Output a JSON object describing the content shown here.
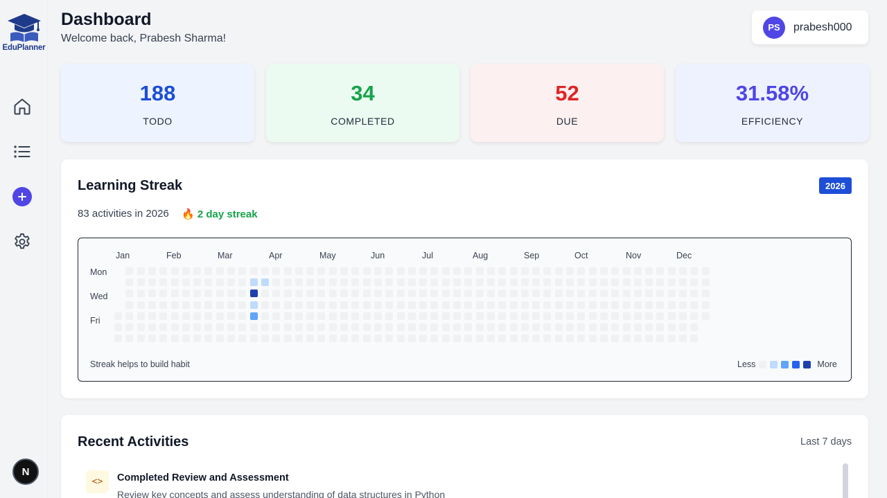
{
  "sidebar": {
    "logo_text": "EduPlanner",
    "bottom_badge": "N",
    "icons": [
      "home-icon",
      "list-icon",
      "plus-icon",
      "gear-icon"
    ]
  },
  "header": {
    "title": "Dashboard",
    "subtitle": "Welcome back, Prabesh Sharma!",
    "user_initials": "PS",
    "username": "prabesh000"
  },
  "stats": [
    {
      "value": "188",
      "label": "TODO",
      "color": "#1d4ed8"
    },
    {
      "value": "34",
      "label": "COMPLETED",
      "color": "#16a34a"
    },
    {
      "value": "52",
      "label": "DUE",
      "color": "#dc2626"
    },
    {
      "value": "31.58%",
      "label": "EFFICIENCY",
      "color": "#4f46e5"
    }
  ],
  "streak": {
    "title": "Learning Streak",
    "year": "2026",
    "activity_count": "83 activities in 2026",
    "streak_text": "2 day streak",
    "months": [
      "Jan",
      "Feb",
      "Mar",
      "Apr",
      "May",
      "Jun",
      "Jul",
      "Aug",
      "Sep",
      "Oct",
      "Nov",
      "Dec"
    ],
    "day_labels": [
      "Mon",
      "Wed",
      "Fri"
    ],
    "footer": "Streak helps to build habit",
    "legend_less": "Less",
    "legend_more": "More",
    "legend_colors": [
      "#f0f1f3",
      "#bfdbfe",
      "#60a5fa",
      "#2563eb",
      "#1e40af"
    ],
    "active_cells": [
      {
        "week": 12,
        "day": 1,
        "level": 1
      },
      {
        "week": 13,
        "day": 1,
        "level": 1
      },
      {
        "week": 12,
        "day": 2,
        "level": 4
      },
      {
        "week": 12,
        "day": 3,
        "level": 1
      },
      {
        "week": 12,
        "day": 4,
        "level": 2
      },
      {
        "week": 12,
        "day": 7,
        "level": 1
      }
    ]
  },
  "recent": {
    "title": "Recent Activities",
    "range": "Last 7 days",
    "items": [
      {
        "icon": "code-icon",
        "title": "Completed Review and Assessment",
        "description": "Review key concepts and assess understanding of data structures in Python"
      }
    ]
  },
  "colors": {
    "accent": "#4f46e5",
    "primary_blue": "#1d4ed8"
  }
}
